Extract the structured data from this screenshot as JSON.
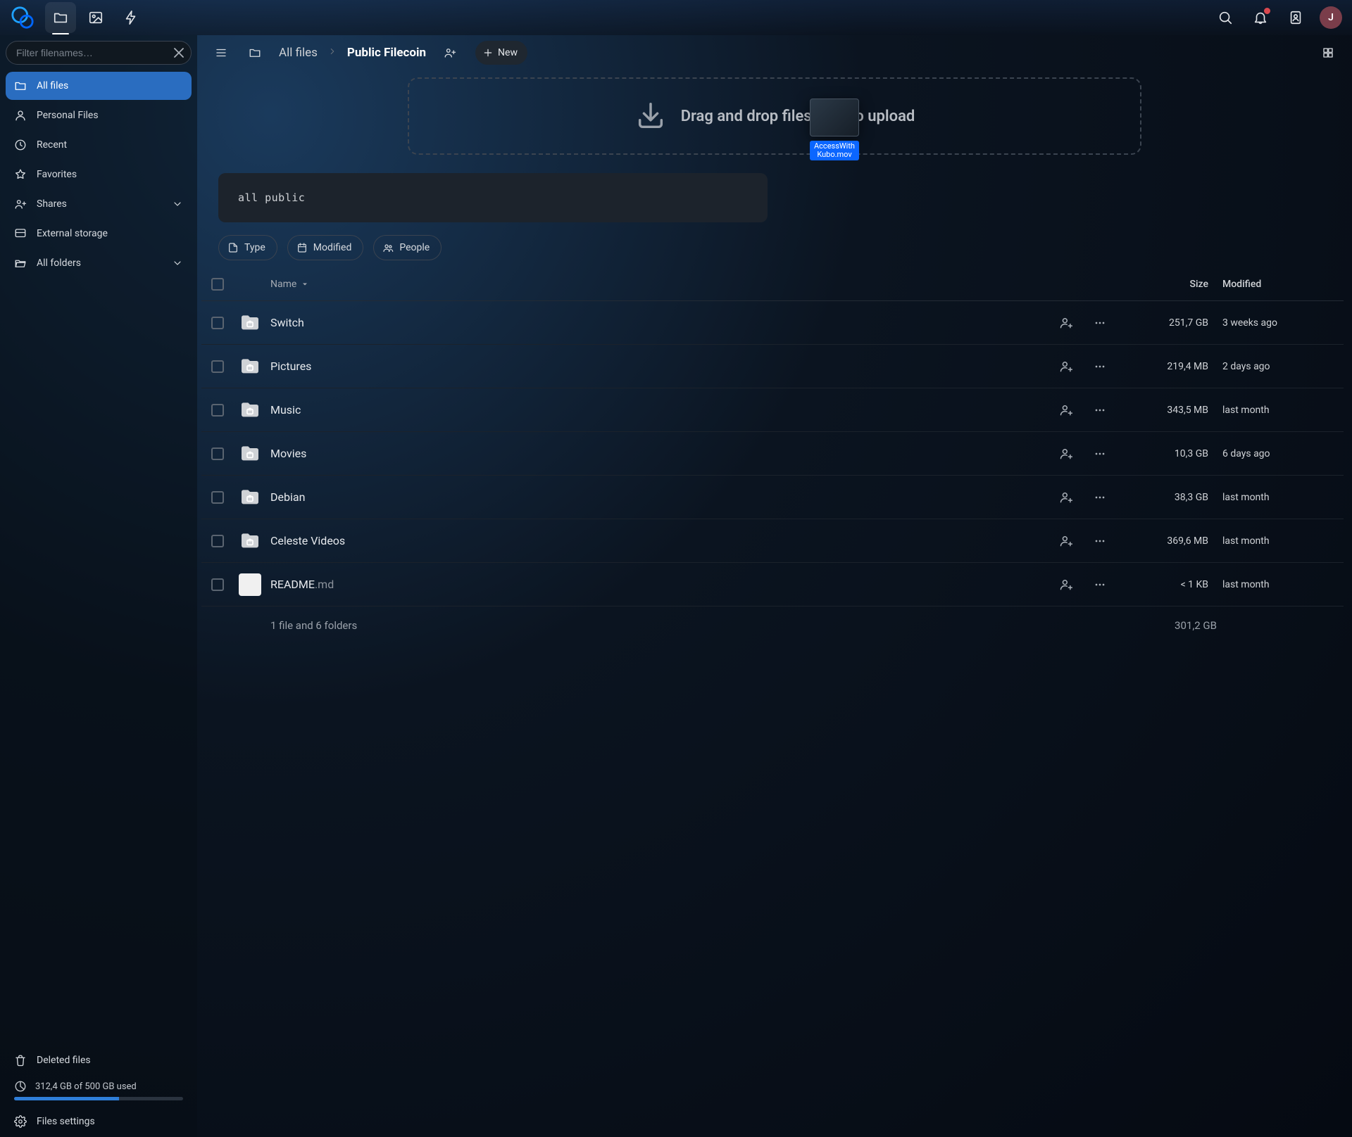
{
  "topbar": {
    "avatar_initial": "J"
  },
  "sidebar": {
    "filter_placeholder": "Filter filenames…",
    "items": [
      {
        "key": "all-files",
        "label": "All files",
        "icon": "folder",
        "selected": true
      },
      {
        "key": "personal",
        "label": "Personal Files",
        "icon": "user"
      },
      {
        "key": "recent",
        "label": "Recent",
        "icon": "clock"
      },
      {
        "key": "favorites",
        "label": "Favorites",
        "icon": "star"
      },
      {
        "key": "shares",
        "label": "Shares",
        "icon": "share",
        "expandable": true
      },
      {
        "key": "external",
        "label": "External storage",
        "icon": "external"
      },
      {
        "key": "all-folders",
        "label": "All folders",
        "icon": "folder-open",
        "expandable": true
      }
    ],
    "deleted_label": "Deleted files",
    "quota_text": "312,4 GB of 500 GB used",
    "quota_percent": 62,
    "settings_label": "Files settings"
  },
  "breadcrumb": {
    "root": "All files",
    "segments": [
      "Public Filecoin"
    ]
  },
  "toolbar": {
    "new_label": "New"
  },
  "dropzone": {
    "text": "Drag and drop files here to upload",
    "drag_ghost_label": "AccessWithKubo.mov"
  },
  "description": "all public",
  "chips": [
    {
      "key": "type",
      "label": "Type",
      "icon": "file"
    },
    {
      "key": "modified",
      "label": "Modified",
      "icon": "calendar"
    },
    {
      "key": "people",
      "label": "People",
      "icon": "people"
    }
  ],
  "table": {
    "headers": {
      "name": "Name",
      "size": "Size",
      "modified": "Modified"
    },
    "rows": [
      {
        "name": "Switch",
        "kind": "folder",
        "size": "251,7 GB",
        "modified": "3 weeks ago"
      },
      {
        "name": "Pictures",
        "kind": "folder",
        "size": "219,4 MB",
        "modified": "2 days ago"
      },
      {
        "name": "Music",
        "kind": "folder",
        "size": "343,5 MB",
        "modified": "last month"
      },
      {
        "name": "Movies",
        "kind": "folder",
        "size": "10,3 GB",
        "modified": "6 days ago"
      },
      {
        "name": "Debian",
        "kind": "folder",
        "size": "38,3 GB",
        "modified": "last month"
      },
      {
        "name": "Celeste Videos",
        "kind": "folder",
        "size": "369,6 MB",
        "modified": "last month"
      },
      {
        "name": "README",
        "ext": ".md",
        "kind": "file",
        "size": "< 1 KB",
        "modified": "last month"
      }
    ],
    "summary": "1 file and 6 folders",
    "total_size": "301,2 GB"
  },
  "colors": {
    "accent": "#2d6fc4",
    "folder": "#1a73e8"
  }
}
